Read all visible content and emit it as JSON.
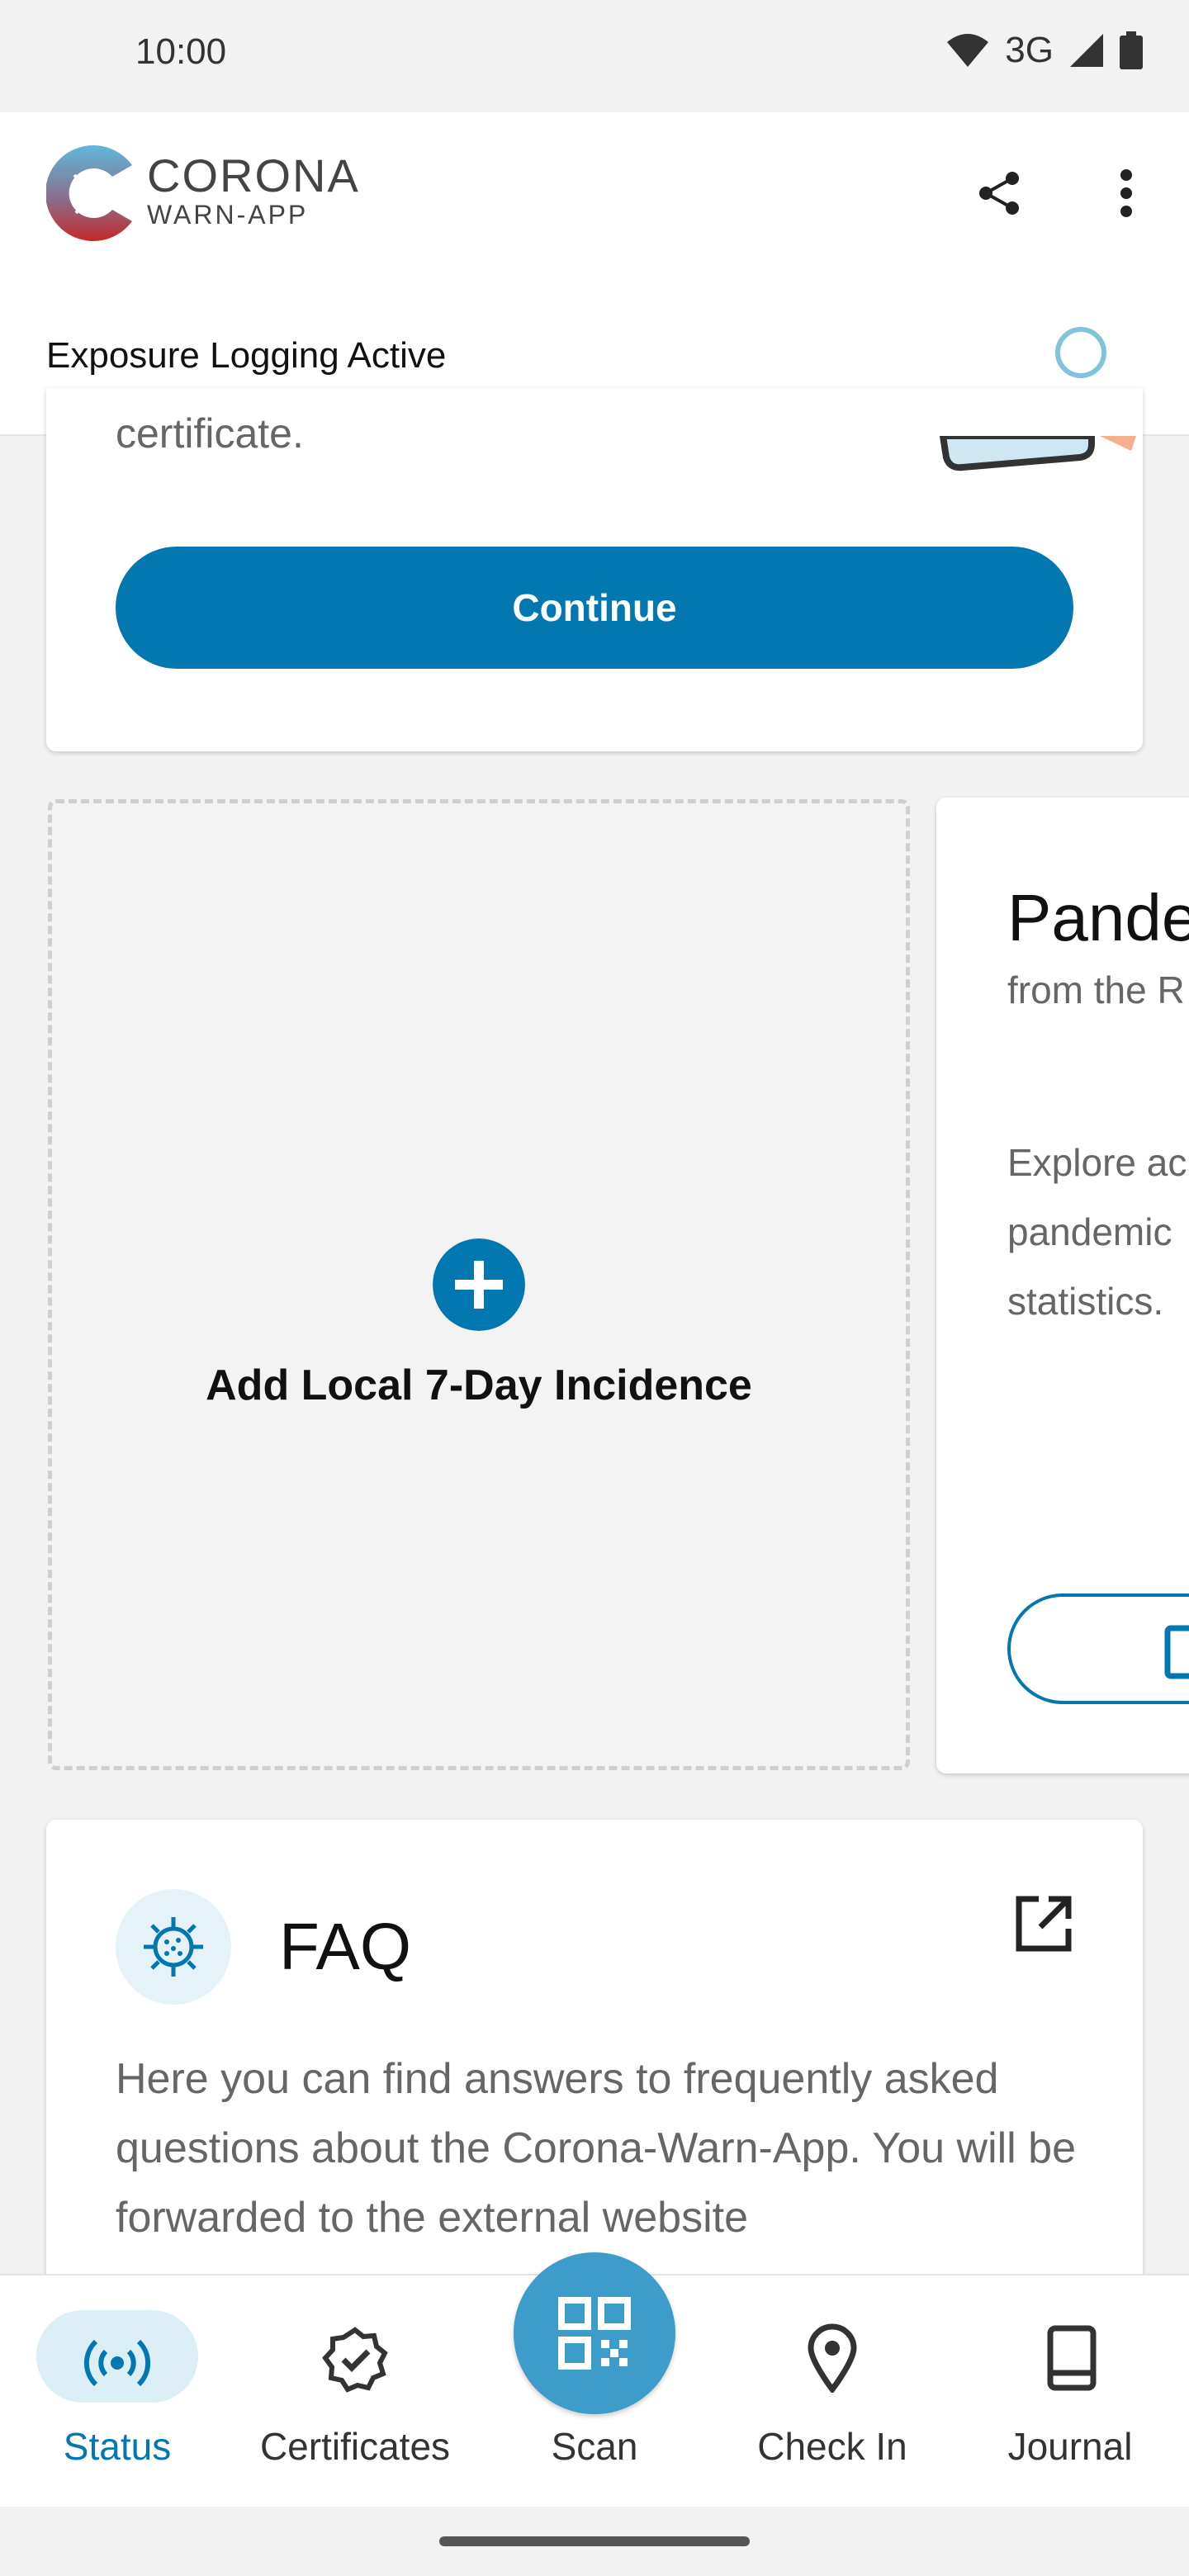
{
  "status_bar": {
    "time": "10:00",
    "network": "3G"
  },
  "header": {
    "logo_line1": "CORONA",
    "logo_line2": "WARN-APP",
    "exposure_status": "Exposure Logging Active"
  },
  "top_card": {
    "partial_text": "certificate.",
    "continue_label": "Continue"
  },
  "incidence_card": {
    "label": "Add Local 7-Day Incidence"
  },
  "pandemic_card": {
    "title": "Pande",
    "subtitle": "from the R",
    "body": [
      "Explore ac",
      "pandemic",
      "statistics."
    ]
  },
  "faq_card": {
    "title": "FAQ",
    "body": "Here you can find answers to frequently asked questions about the Corona-Warn-App. You will be forwarded to the external website"
  },
  "bottom_nav": {
    "items": [
      {
        "label": "Status",
        "active": true
      },
      {
        "label": "Certificates",
        "active": false
      },
      {
        "label": "Scan",
        "active": false
      },
      {
        "label": "Check In",
        "active": false
      },
      {
        "label": "Journal",
        "active": false
      }
    ]
  },
  "colors": {
    "accent": "#0277b0",
    "scan_fab": "#3e9ccb",
    "active_pill": "#dceef6",
    "exposure_ring": "#7fc4d9"
  }
}
